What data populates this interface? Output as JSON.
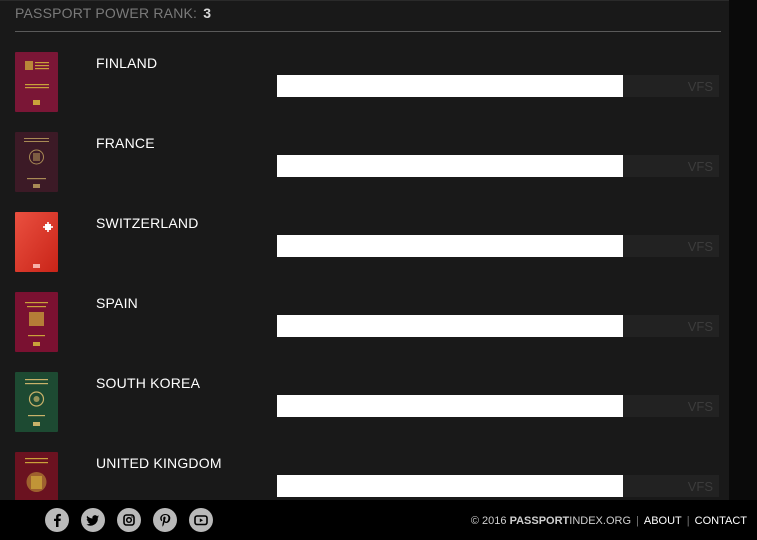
{
  "header": {
    "rank_label": "PASSPORT POWER RANK:",
    "rank_value": "3"
  },
  "countries": [
    {
      "name": "FINLAND",
      "bar_label": "VFS",
      "score_fraction": 0.783,
      "cover_color": "#7a1636"
    },
    {
      "name": "FRANCE",
      "bar_label": "VFS",
      "score_fraction": 0.783,
      "cover_color": "#3c1a26"
    },
    {
      "name": "SWITZERLAND",
      "bar_label": "VFS",
      "score_fraction": 0.783,
      "cover_color": "#e2342a"
    },
    {
      "name": "SPAIN",
      "bar_label": "VFS",
      "score_fraction": 0.783,
      "cover_color": "#7a1131"
    },
    {
      "name": "SOUTH KOREA",
      "bar_label": "VFS",
      "score_fraction": 0.783,
      "cover_color": "#1d4a32"
    },
    {
      "name": "UNITED KINGDOM",
      "bar_label": "VFS",
      "score_fraction": 0.783,
      "cover_color": "#6b1220"
    }
  ],
  "footer": {
    "social": [
      "facebook-icon",
      "twitter-icon",
      "instagram-icon",
      "pinterest-icon",
      "youtube-icon"
    ],
    "copyright_prefix": "© 2016",
    "brand_bold": "PASSPORT",
    "brand_rest": "INDEX.ORG",
    "links": [
      "ABOUT",
      "CONTACT"
    ]
  },
  "colors": {
    "background": "#191919",
    "bar_fill": "#ffffff",
    "bar_track": "#222222",
    "bar_label": "#3c3c3c"
  }
}
